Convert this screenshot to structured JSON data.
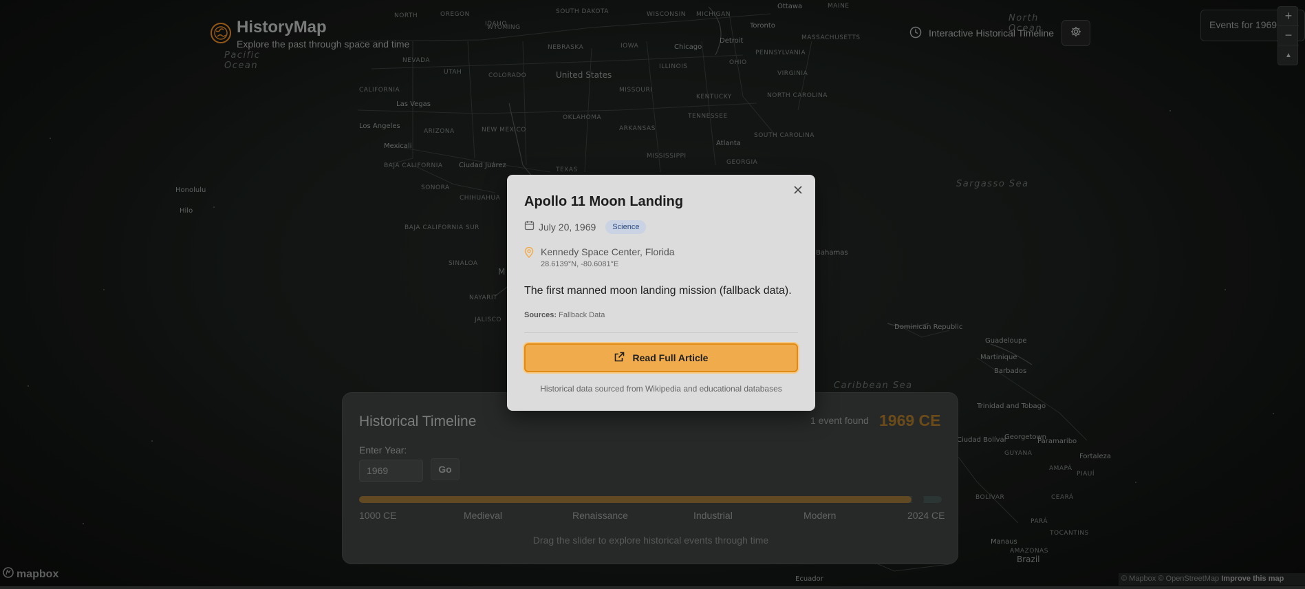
{
  "header": {
    "brand_title": "HistoryMap",
    "brand_subtitle": "Explore the past through space and time",
    "timeline_link": "Interactive Historical Timeline",
    "events_panel": "Events for 1969"
  },
  "map": {
    "labels": {
      "north_america_north": "NORTH",
      "oregon": "OREGON",
      "idaho": "IDAHO",
      "south_dakota": "SOUTH DAKOTA",
      "wisconsin": "WISCONSIN",
      "michigan": "MICHIGAN",
      "ottawa": "Ottawa",
      "maine": "MAINE",
      "toronto": "Toronto",
      "wyoming": "WYOMING",
      "nebraska": "NEBRASKA",
      "iowa": "IOWA",
      "detroit": "Detroit",
      "chicago": "Chicago",
      "massachusetts": "MASSACHUSETTS",
      "nevada": "NEVADA",
      "utah": "UTAH",
      "colorado": "COLORADO",
      "united_states": "United States",
      "illinois": "ILLINOIS",
      "ohio": "OHIO",
      "pennsylvania": "PENNSYLVANIA",
      "california": "CALIFORNIA",
      "missouri": "MISSOURI",
      "virginia": "VIRGINIA",
      "las_vegas": "Las Vegas",
      "kentucky": "KENTUCKY",
      "oklahoma": "OKLAHOMA",
      "tennessee": "TENNESSEE",
      "north_carolina": "NORTH CAROLINA",
      "los_angeles": "Los Angeles",
      "arizona": "ARIZONA",
      "new_mexico": "NEW MEXICO",
      "arkansas": "ARKANSAS",
      "mexicali": "Mexicali",
      "atlanta": "Atlanta",
      "south_carolina": "SOUTH CAROLINA",
      "mississippi": "MISSISSIPPI",
      "georgia": "GEORGIA",
      "ciudad_juarez": "Ciudad Juárez",
      "texas": "TEXAS",
      "baja_california": "BAJA CALIFORNIA",
      "sonora": "SONORA",
      "chihuahua": "CHIHUAHUA",
      "honolulu": "Honolulu",
      "hilo": "Hilo",
      "sargasso_sea": "Sargasso Sea",
      "baja_california_sur": "BAJA CALIFORNIA SUR",
      "sinaloa": "SINALOA",
      "bahamas": "Bahamas",
      "mexico_m": "M",
      "nayarit": "NAYARIT",
      "jalisco": "JALISCO",
      "dominican_republic": "Dominican Republic",
      "guadeloupe": "Guadeloupe",
      "martinique": "Martinique",
      "barbados": "Barbados",
      "caribbean_sea": "Caribbean Sea",
      "trinidad": "Trinidad and Tobago",
      "ciudad_bolivar": "Ciudad Bolívar",
      "georgetown": "Georgetown",
      "paramaribo": "Paramaribo",
      "fortaleza": "Fortaleza",
      "guyana": "GUYANA",
      "amapa": "AMAPÁ",
      "para": "PARÁ",
      "bolivar": "BOLÍVAR",
      "manaus": "Manaus",
      "brazil": "Brazil",
      "amazonas": "AMAZONAS",
      "piaui": "PIAUÍ",
      "ceara": "CEARÁ",
      "ecuador": "Ecuador",
      "tocantins": "TOCANTINS",
      "pacific_ocean": "Pacific\nOcean",
      "north_ocean": "North\nOcean"
    }
  },
  "zoom": {
    "in": "+",
    "out": "−",
    "reset": "▲"
  },
  "mapbox": {
    "logo": "mapbox"
  },
  "attribution": {
    "copy1": "© Mapbox",
    "copy2": "© OpenStreetMap",
    "improve": "Improve this map"
  },
  "timeline": {
    "title": "Historical Timeline",
    "count": "1 event found",
    "year_label": "1969 CE",
    "enter_label": "Enter Year:",
    "year_value": "1969",
    "go_label": "Go",
    "slider_fraction": 0.948,
    "ticks": [
      "1000 CE",
      "Medieval",
      "Renaissance",
      "Industrial",
      "Modern",
      "2024 CE"
    ],
    "hint": "Drag the slider to explore historical events through time"
  },
  "modal": {
    "title": "Apollo 11 Moon Landing",
    "date": "July 20, 1969",
    "category": "Science",
    "location": "Kennedy Space Center, Florida",
    "coords": "28.6139°N, -80.6081°E",
    "description": "The first manned moon landing mission (fallback data).",
    "sources_label": "Sources:",
    "sources_value": "Fallback Data",
    "read_button": "Read Full Article",
    "footer": "Historical data sourced from Wikipedia and educational databases"
  },
  "colors": {
    "accent": "#f0ac4c",
    "accent_border": "#e08a17",
    "badge_bg": "#c9d3e3",
    "badge_text": "#2b4a82",
    "slider_fill": "#6e5428"
  }
}
